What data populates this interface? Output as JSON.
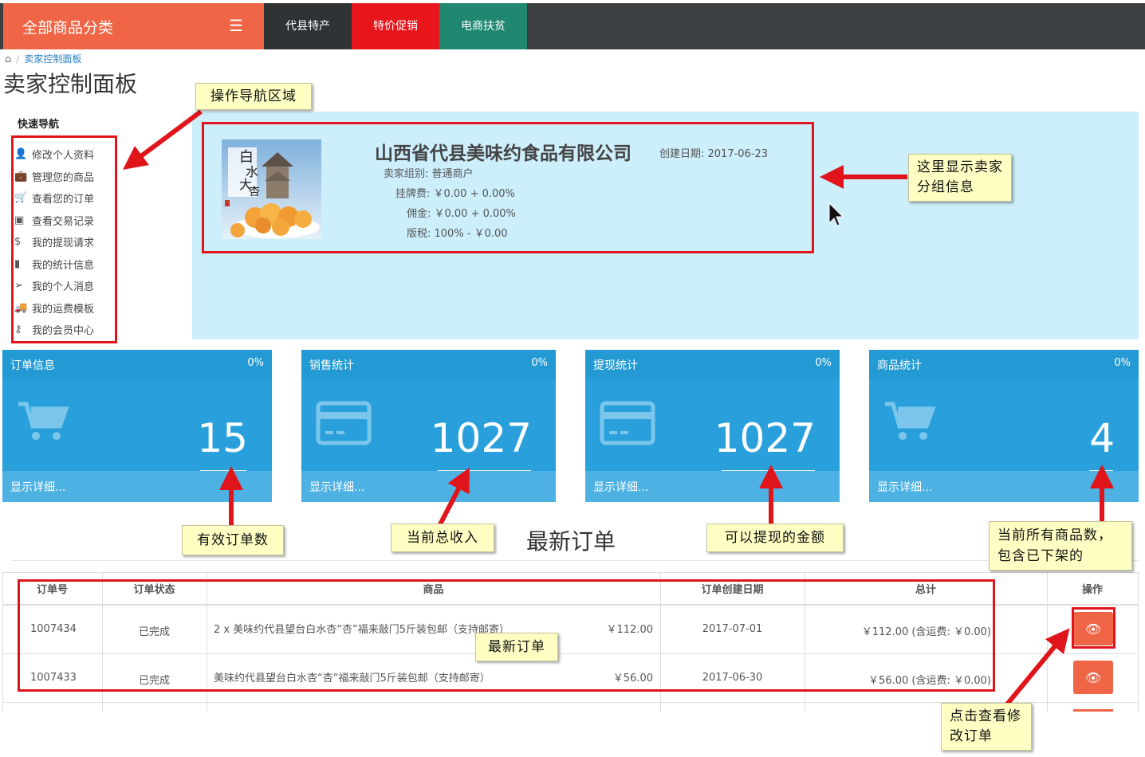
{
  "nav": {
    "all_categories": "全部商品分类",
    "tabs": [
      {
        "label": "代县特产",
        "color": "#2f3336"
      },
      {
        "label": "特价促销",
        "color": "#e8151b"
      },
      {
        "label": "电商扶贫",
        "color": "#208770"
      }
    ]
  },
  "breadcrumb": {
    "current": "卖家控制面板"
  },
  "page_title": "卖家控制面板",
  "quick_nav": {
    "title": "快速导航",
    "items": [
      {
        "label": "修改个人资料",
        "icon": "user-icon"
      },
      {
        "label": "管理您的商品",
        "icon": "briefcase-icon"
      },
      {
        "label": "查看您的订单",
        "icon": "cart-icon"
      },
      {
        "label": "查看交易记录",
        "icon": "money-icon"
      },
      {
        "label": "我的提现请求",
        "icon": "dollar-icon"
      },
      {
        "label": "我的统计信息",
        "icon": "bar-chart-icon"
      },
      {
        "label": "我的个人消息",
        "icon": "paper-plane-icon"
      },
      {
        "label": "我的运费模板",
        "icon": "truck-icon"
      },
      {
        "label": "我的会员中心",
        "icon": "key-icon"
      }
    ]
  },
  "seller": {
    "company": "山西省代县美味约食品有限公司",
    "created": "创建日期: 2017-06-23",
    "group": "卖家组别: 普通商户",
    "listing_fee": "挂牌费: ￥0.00 + 0.00%",
    "commission": "佣金: ￥0.00 + 0.00%",
    "tax": "版税: 100% - ￥0.00",
    "logo_text": "白水大杏"
  },
  "stats": [
    {
      "title": "订单信息",
      "pct": "0%",
      "value": "15",
      "footer": "显示详细...",
      "icon": "cart-icon"
    },
    {
      "title": "销售统计",
      "pct": "0%",
      "value": "1027",
      "footer": "显示详细...",
      "icon": "credit-card-icon"
    },
    {
      "title": "提现统计",
      "pct": "0%",
      "value": "1027",
      "footer": "显示详细...",
      "icon": "credit-card-icon"
    },
    {
      "title": "商品统计",
      "pct": "0%",
      "value": "4",
      "footer": "显示详细...",
      "icon": "cart-icon"
    }
  ],
  "orders": {
    "title": "最新订单",
    "headers": [
      "订单号",
      "订单状态",
      "商品",
      "订单创建日期",
      "总计",
      "操作"
    ],
    "rows": [
      {
        "id": "1007434",
        "status": "已完成",
        "item": "2 x 美味约代县望台白水杏“杏”福来敲门5斤装包邮（支持邮寄）",
        "price": "￥112.00",
        "date": "2017-07-01",
        "total": "￥112.00 (含运费: ￥0.00)"
      },
      {
        "id": "1007433",
        "status": "已完成",
        "item": "美味约代县望台白水杏“杏”福来敲门5斤装包邮（支持邮寄）",
        "price": "￥56.00",
        "date": "2017-06-30",
        "total": "￥56.00 (含运费: ￥0.00)"
      }
    ]
  },
  "annotations": {
    "nav_area": "操作导航区域",
    "seller_group": "这里显示卖家分组信息",
    "valid_orders": "有效订单数",
    "total_income": "当前总收入",
    "withdrawable": "可以提现的金额",
    "product_count": "当前所有商品数，包含已下架的",
    "latest_orders": "最新订单",
    "view_edit": "点击查看修改订单"
  }
}
